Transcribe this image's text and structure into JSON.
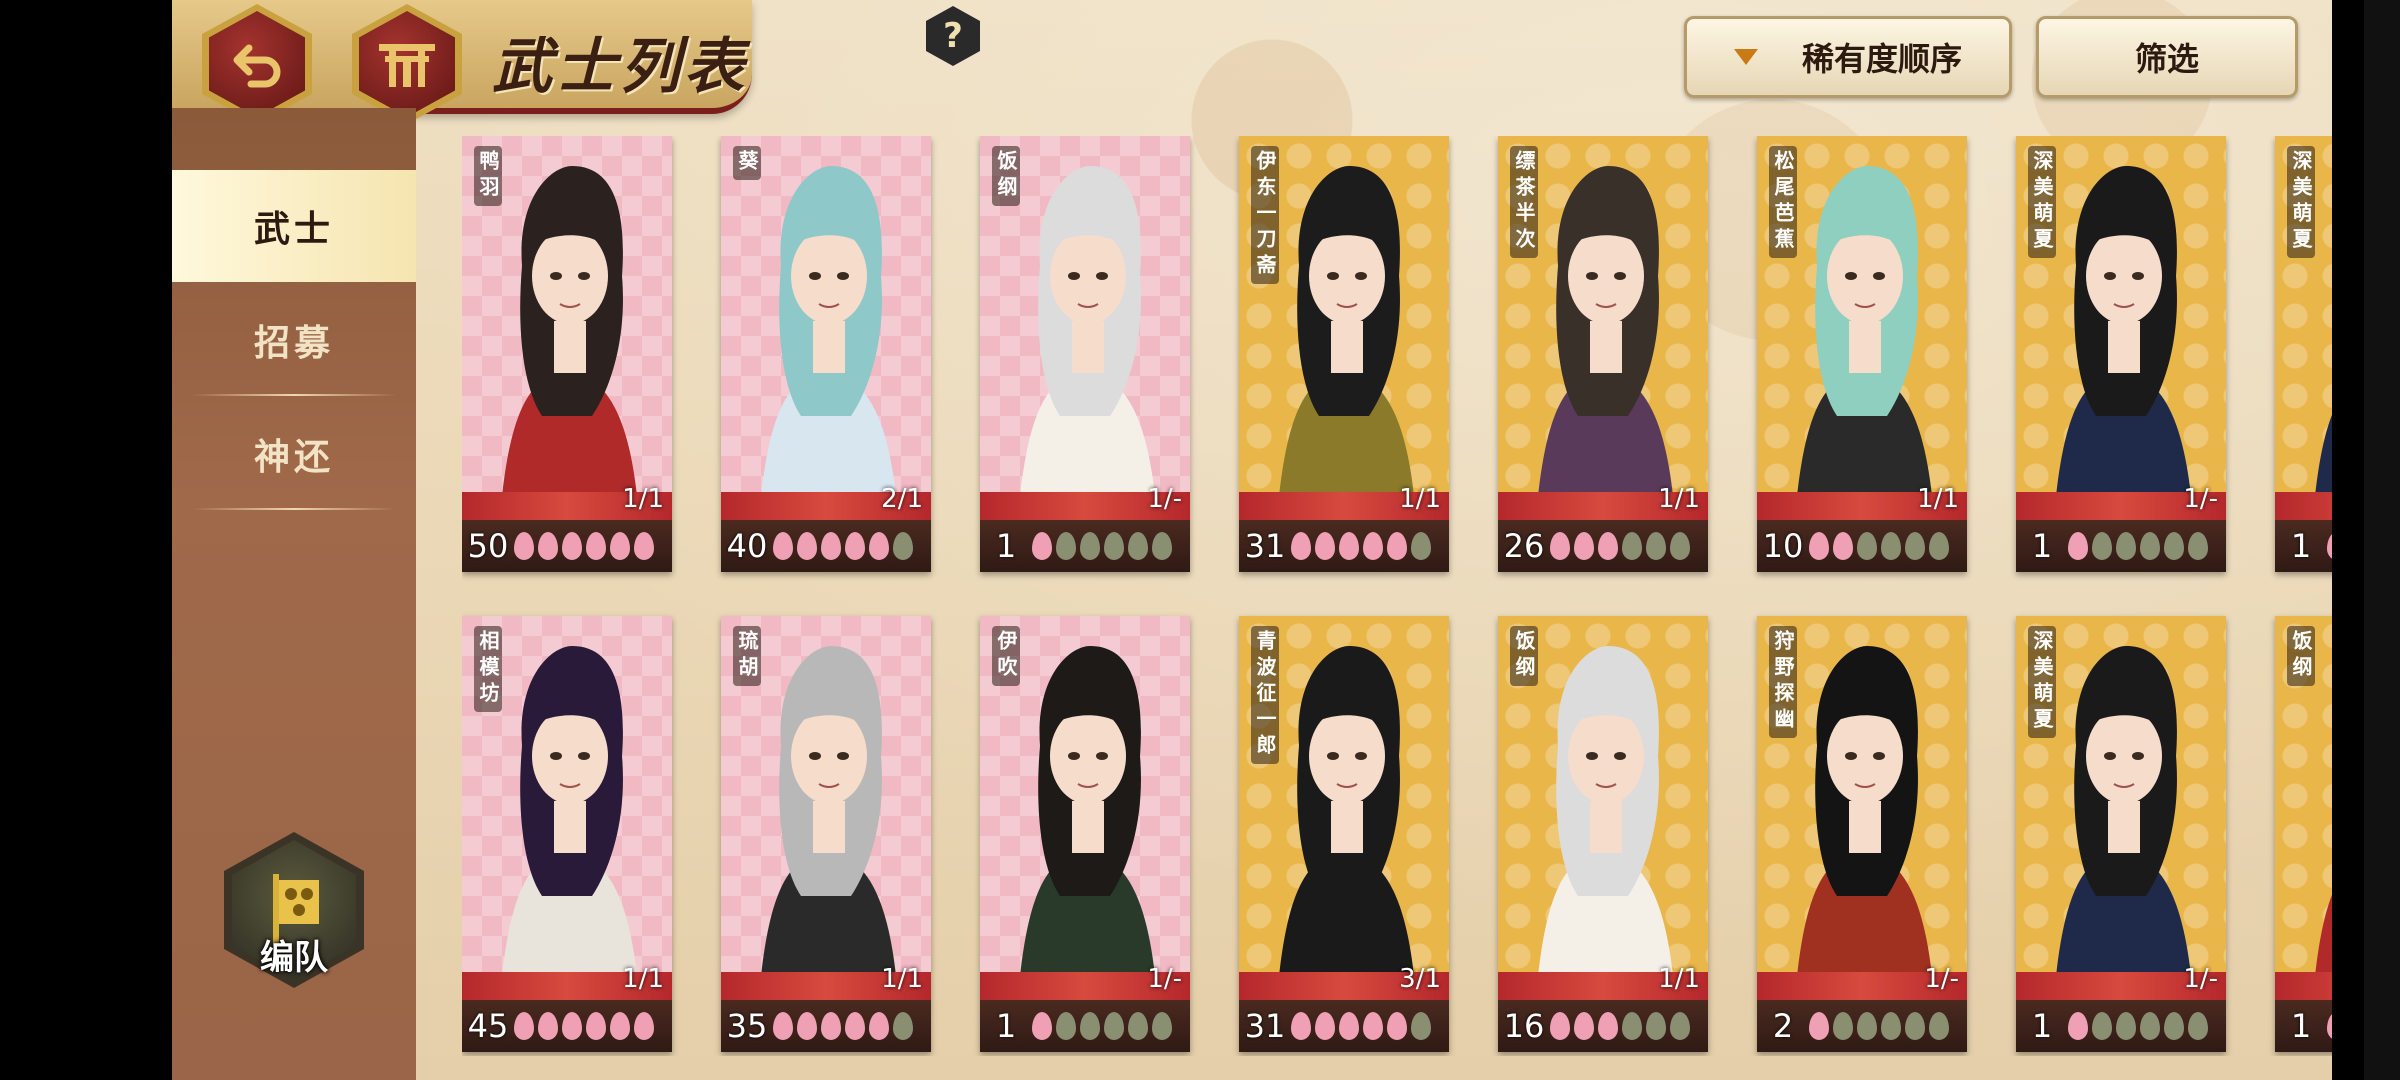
{
  "header": {
    "title": "武士列表",
    "help": "?",
    "sort_label": "稀有度顺序",
    "filter_label": "筛选"
  },
  "sidebar": {
    "items": [
      {
        "label": "武士",
        "active": true
      },
      {
        "label": "招募",
        "active": false
      },
      {
        "label": "神还",
        "active": false
      }
    ],
    "team_label": "编队"
  },
  "colors": {
    "accent": "#7a1f1c",
    "petal_on": "#f0a0b4",
    "petal_off": "#8a8f72"
  },
  "cards": [
    {
      "name": "鸭羽",
      "level": "50",
      "count": "1/1",
      "petals": 6,
      "bg": "pink",
      "hair": "#2b2220",
      "cloth": "#b02a2a"
    },
    {
      "name": "葵",
      "level": "40",
      "count": "2/1",
      "petals": 5,
      "bg": "pink",
      "hair": "#8fc8c8",
      "cloth": "#d8e6ef"
    },
    {
      "name": "饭纲",
      "level": "1",
      "count": "1/-",
      "petals": 1,
      "bg": "pink",
      "hair": "#dcdcdc",
      "cloth": "#f4f0e8"
    },
    {
      "name": "伊东一刀斋",
      "level": "31",
      "count": "1/1",
      "petals": 5,
      "bg": "gold",
      "hair": "#1c1c1c",
      "cloth": "#8a7a2a"
    },
    {
      "name": "缥茶半次",
      "level": "26",
      "count": "1/1",
      "petals": 3,
      "bg": "gold",
      "hair": "#3a302a",
      "cloth": "#5a3a5a"
    },
    {
      "name": "松尾芭蕉",
      "level": "10",
      "count": "1/1",
      "petals": 2,
      "bg": "gold",
      "hair": "#8fcfc0",
      "cloth": "#2a2a2a"
    },
    {
      "name": "深美萌夏",
      "level": "1",
      "count": "1/-",
      "petals": 1,
      "bg": "gold",
      "hair": "#1a1a1a",
      "cloth": "#1f2a4a"
    },
    {
      "name": "深美萌夏",
      "level": "1",
      "count": "",
      "petals": 1,
      "bg": "gold",
      "hair": "#1a1a1a",
      "cloth": "#1f2a4a"
    },
    {
      "name": "相模坊",
      "level": "45",
      "count": "1/1",
      "petals": 6,
      "bg": "pink",
      "hair": "#2a1a3a",
      "cloth": "#e8e4dc"
    },
    {
      "name": "琉胡",
      "level": "35",
      "count": "1/1",
      "petals": 5,
      "bg": "pink",
      "hair": "#b8b8b8",
      "cloth": "#2a2a2a"
    },
    {
      "name": "伊吹",
      "level": "1",
      "count": "1/-",
      "petals": 1,
      "bg": "pink",
      "hair": "#1e1a18",
      "cloth": "#2a3a2a"
    },
    {
      "name": "青波征一郎",
      "level": "31",
      "count": "3/1",
      "petals": 5,
      "bg": "gold",
      "hair": "#1a1a1a",
      "cloth": "#1a1a1a"
    },
    {
      "name": "饭纲",
      "level": "16",
      "count": "1/1",
      "petals": 3,
      "bg": "gold",
      "hair": "#dcdcdc",
      "cloth": "#f4f0e8"
    },
    {
      "name": "狩野探幽",
      "level": "2",
      "count": "1/-",
      "petals": 1,
      "bg": "gold",
      "hair": "#141414",
      "cloth": "#a03020"
    },
    {
      "name": "深美萌夏",
      "level": "1",
      "count": "1/-",
      "petals": 1,
      "bg": "gold",
      "hair": "#1a1a1a",
      "cloth": "#1f2a4a"
    },
    {
      "name": "饭纲",
      "level": "1",
      "count": "",
      "petals": 1,
      "bg": "gold",
      "hair": "#dcdcdc",
      "cloth": "#b02a2a"
    }
  ]
}
